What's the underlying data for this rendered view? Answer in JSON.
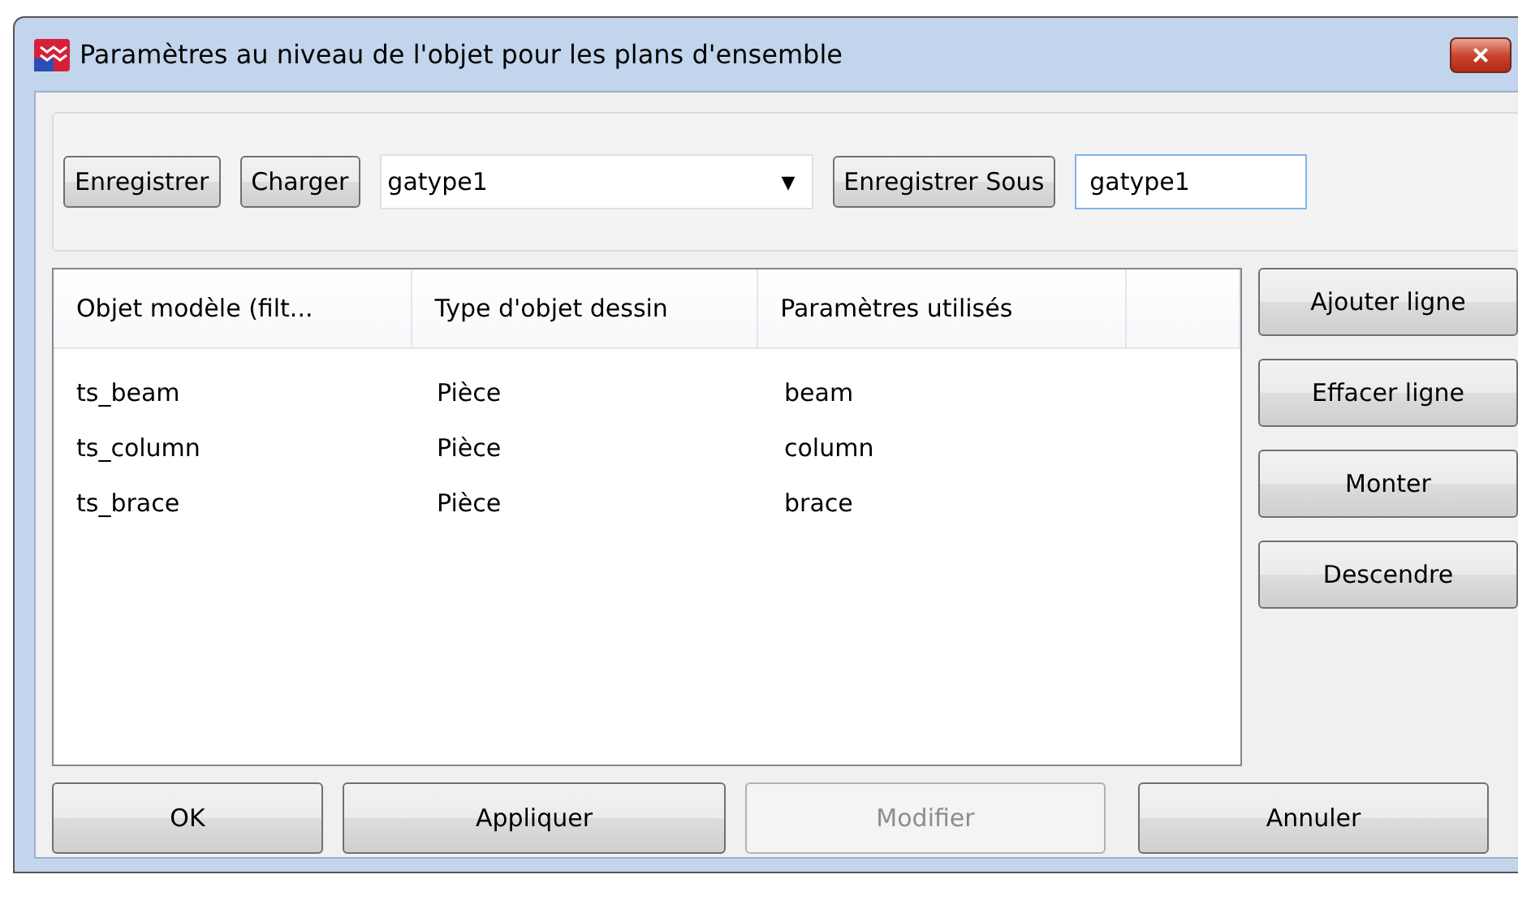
{
  "window": {
    "title": "Paramètres au niveau de l'objet pour les plans d'ensemble",
    "close": "×"
  },
  "toolbar": {
    "save_button": "Enregistrer",
    "load_button": "Charger",
    "preset_combo": {
      "value": "gatype1",
      "arrow": "▼"
    },
    "save_as_button": "Enregistrer Sous",
    "name_field": {
      "value": "gatype1"
    }
  },
  "table": {
    "columns": [
      "Objet modèle (filt...",
      "Type d'objet dessin",
      "Paramètres utilisés"
    ],
    "rows": [
      [
        "ts_beam",
        "Pièce",
        "beam"
      ],
      [
        "ts_column",
        "Pièce",
        "column"
      ],
      [
        "ts_brace",
        "Pièce",
        "brace"
      ]
    ]
  },
  "side_buttons": [
    {
      "label": "Ajouter ligne",
      "disabled": false
    },
    {
      "label": "Effacer ligne",
      "disabled": false
    },
    {
      "label": "Monter",
      "disabled": false
    },
    {
      "label": "Descendre",
      "disabled": false
    }
  ],
  "bottom_buttons": [
    {
      "label": "OK",
      "disabled": false
    },
    {
      "label": "Appliquer",
      "disabled": false
    },
    {
      "label": "Modifier",
      "disabled": true
    },
    {
      "label": "Annuler",
      "disabled": false
    }
  ]
}
